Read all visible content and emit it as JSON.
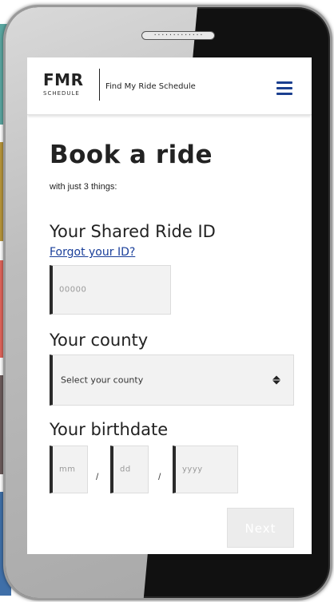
{
  "brand": {
    "logo_main": "FMR",
    "logo_sub": "SCHEDULE",
    "site_name": "Find My Ride Schedule"
  },
  "menu": {
    "icon": "hamburger-menu-icon",
    "color": "#1b3f8f"
  },
  "page": {
    "title": "Book a ride",
    "subtitle": "with just 3 things:"
  },
  "ride_id": {
    "label": "Your Shared Ride ID",
    "forgot_link": "Forgot your ID?",
    "placeholder": "00000"
  },
  "county": {
    "label": "Your county",
    "selected": "Select your county"
  },
  "birthdate": {
    "label": "Your birthdate",
    "month_placeholder": "mm",
    "day_placeholder": "dd",
    "year_placeholder": "yyyy",
    "separator": "/"
  },
  "next_button": {
    "label": "Next"
  },
  "device": {
    "speaker_dots": "·············"
  },
  "colors": {
    "link": "#1a3f9a",
    "field_border_accent": "#2a2a2a",
    "strips": [
      "#5aa6a0",
      "#b8963a",
      "#e0645a",
      "#6b5b5b",
      "#3f6fa8"
    ]
  }
}
